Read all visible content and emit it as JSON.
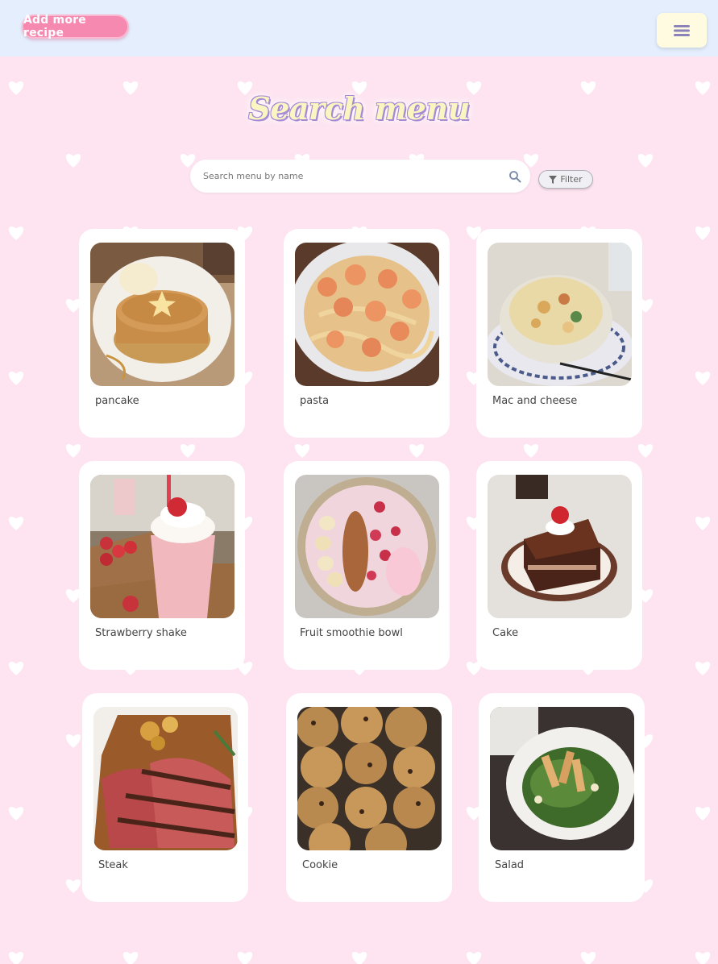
{
  "header": {
    "add_button_label": "Add more recipe",
    "menu_icon": "hamburger-icon"
  },
  "page": {
    "title": "Search menu"
  },
  "search": {
    "placeholder": "Search menu by name",
    "icon": "search-icon"
  },
  "filter": {
    "label": "Filter",
    "icon": "funnel-icon"
  },
  "recipes": [
    {
      "name": "pancake"
    },
    {
      "name": "pasta"
    },
    {
      "name": "Mac and cheese"
    },
    {
      "name": "Strawberry shake"
    },
    {
      "name": "Fruit smoothie bowl"
    },
    {
      "name": "Cake"
    },
    {
      "name": "Steak"
    },
    {
      "name": "Cookie"
    },
    {
      "name": "Salad"
    }
  ],
  "colors": {
    "page_background": "#fde4f0",
    "header_background": "#e4eefc",
    "add_button": "#f589b0",
    "menu_button": "#fffbe0",
    "title_fill": "#fbf5c2",
    "title_outline": "#a58bd6",
    "hearts": "#ffffff"
  }
}
